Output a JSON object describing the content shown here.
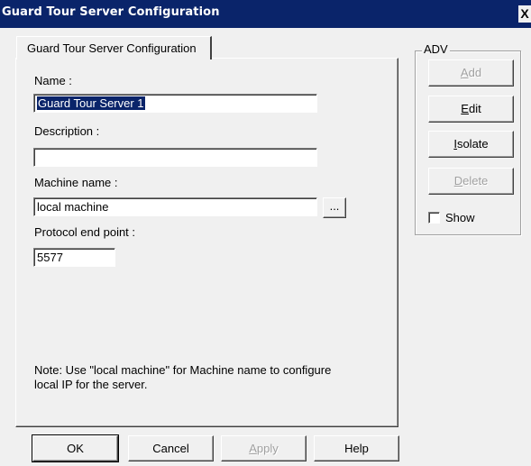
{
  "window": {
    "title": "Guard Tour Server Configuration",
    "close_label": "X"
  },
  "tab": {
    "label": "Guard Tour Server Configuration"
  },
  "form": {
    "name_label": "Name :",
    "name_value": "Guard Tour Server 1",
    "description_label": "Description :",
    "description_value": "",
    "machine_label": "Machine name :",
    "machine_value": "local machine",
    "browse_label": "...",
    "protocol_label": "Protocol end point :",
    "protocol_value": "5577",
    "note_line1": "Note: Use \"local machine\" for Machine name to configure",
    "note_line2": "local IP for the server."
  },
  "adv": {
    "group_label": "ADV",
    "add": {
      "label": "Add",
      "mnemonic": "A",
      "rest": "dd",
      "enabled": false
    },
    "edit": {
      "label": "Edit",
      "mnemonic": "E",
      "rest": "dit",
      "enabled": true
    },
    "isolate": {
      "label": "Isolate",
      "mnemonic": "I",
      "rest": "solate",
      "enabled": true
    },
    "delete": {
      "label": "Delete",
      "mnemonic": "D",
      "rest": "elete",
      "enabled": false
    },
    "show": {
      "label": "Show",
      "mnemonic": "S",
      "rest": "how",
      "checked": false
    }
  },
  "footer": {
    "ok": "OK",
    "cancel": "Cancel",
    "apply": {
      "label": "Apply",
      "mnemonic": "A",
      "rest": "pply",
      "enabled": false
    },
    "help": "Help"
  },
  "colors": {
    "titlebar": "#0a246a",
    "dialog_bg": "#f0f0f0",
    "selection": "#0a246a",
    "disabled_text": "#a0a0a0"
  }
}
